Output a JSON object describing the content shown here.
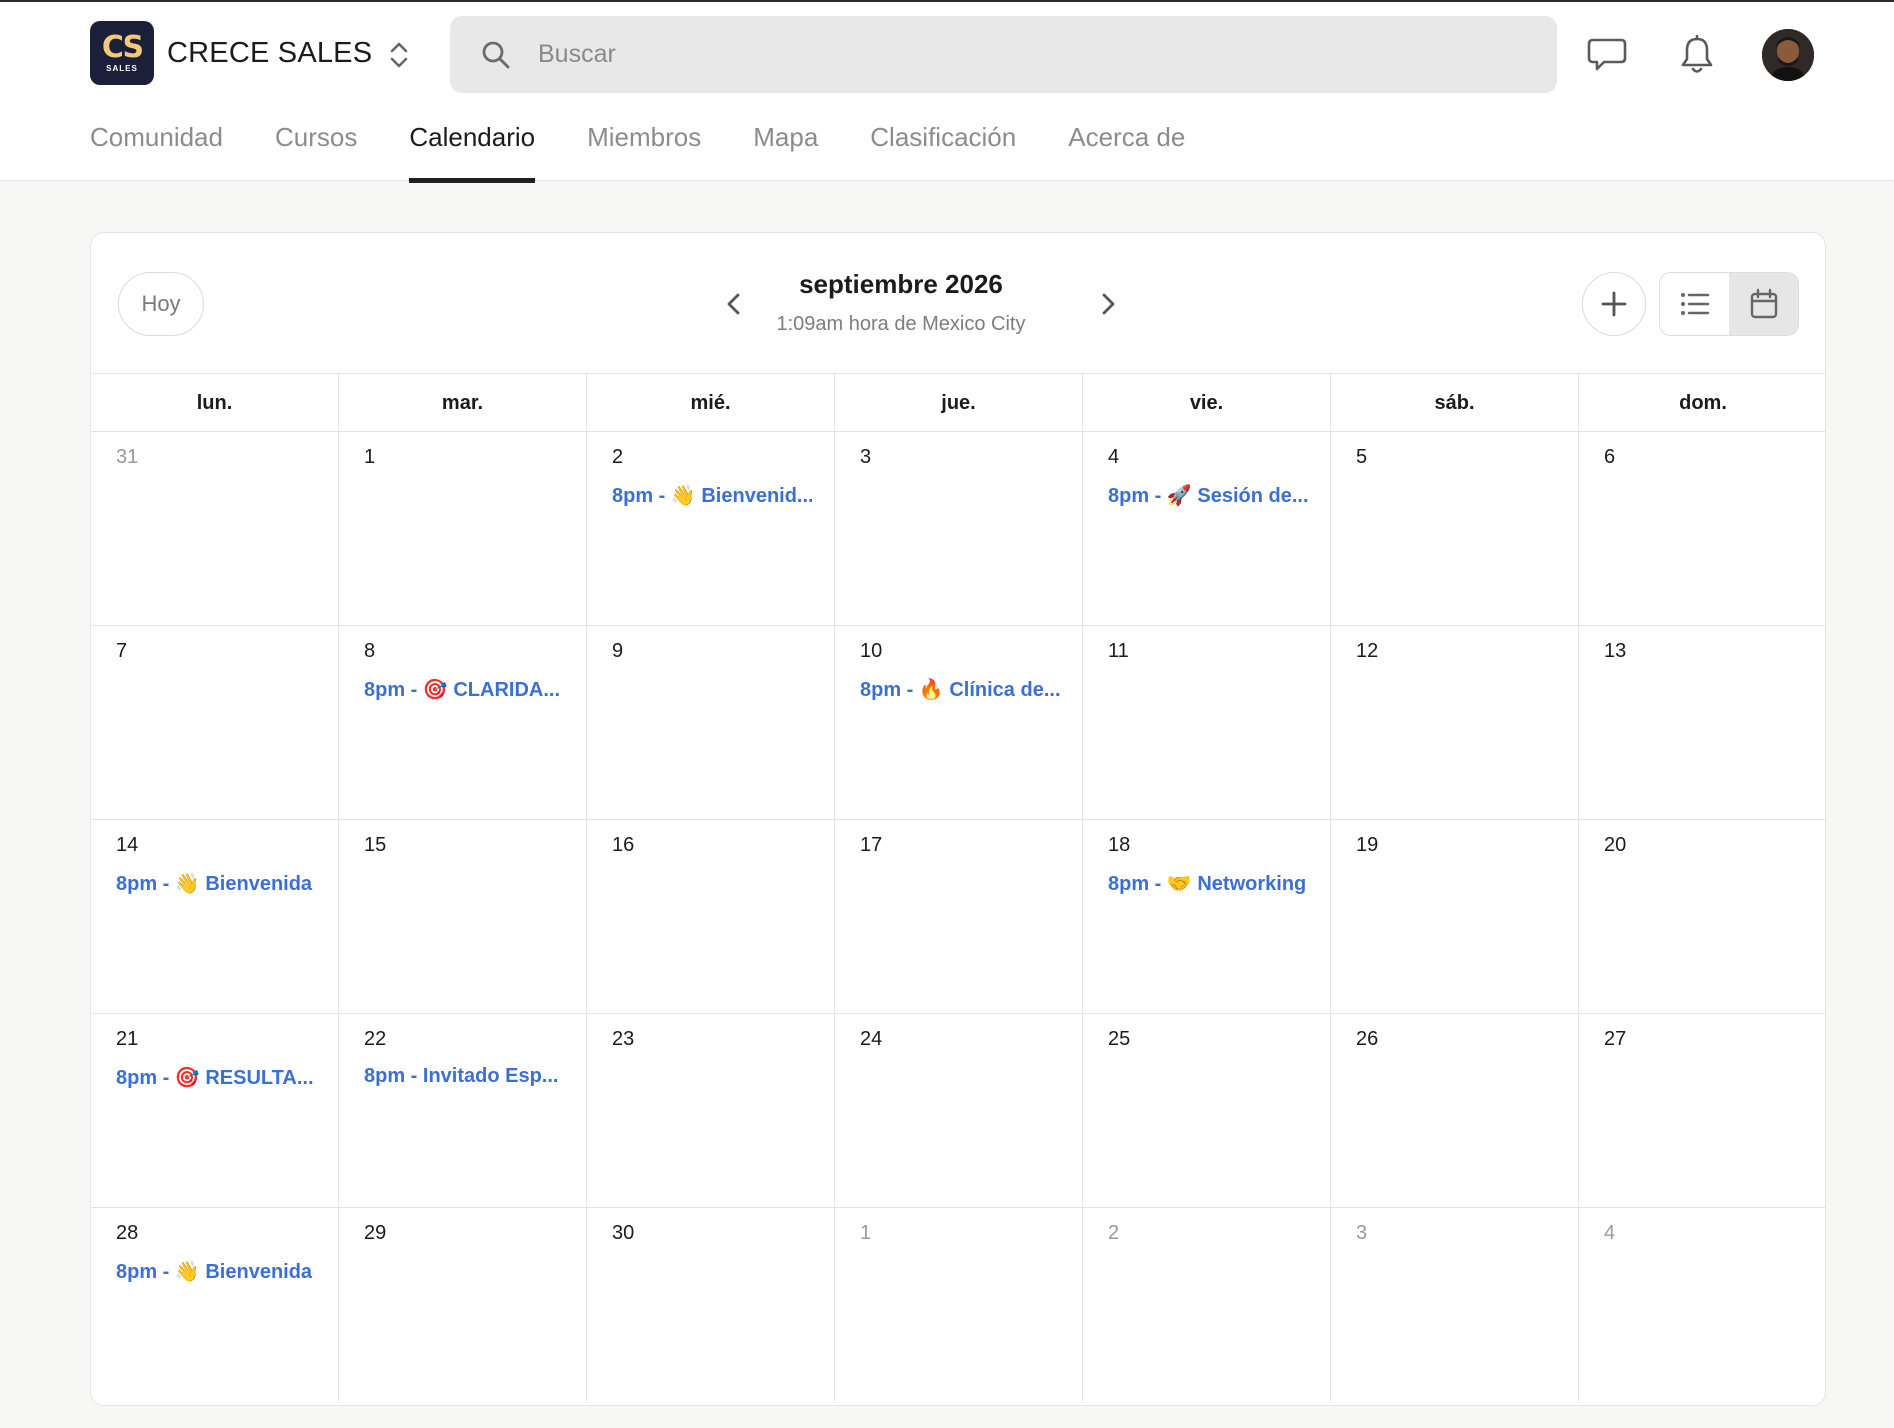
{
  "app": {
    "logo_mark": "CS",
    "logo_sub": "SALES",
    "name": "CRECE SALES"
  },
  "search": {
    "placeholder": "Buscar",
    "value": ""
  },
  "header_icons": [
    "chat-icon",
    "bell-icon"
  ],
  "tabs": [
    {
      "label": "Comunidad",
      "active": false
    },
    {
      "label": "Cursos",
      "active": false
    },
    {
      "label": "Calendario",
      "active": true
    },
    {
      "label": "Miembros",
      "active": false
    },
    {
      "label": "Mapa",
      "active": false
    },
    {
      "label": "Clasificación",
      "active": false
    },
    {
      "label": "Acerca de",
      "active": false
    }
  ],
  "calendar": {
    "today_label": "Hoy",
    "month_title": "septiembre 2026",
    "timezone_text": "1:09am hora de Mexico City",
    "active_view": "calendar",
    "weekdays": [
      "lun.",
      "mar.",
      "mié.",
      "jue.",
      "vie.",
      "sáb.",
      "dom."
    ],
    "weeks": [
      [
        {
          "day": "31",
          "other": true,
          "events": []
        },
        {
          "day": "1",
          "events": []
        },
        {
          "day": "2",
          "events": [
            "8pm - 👋 Bienvenid..."
          ]
        },
        {
          "day": "3",
          "events": []
        },
        {
          "day": "4",
          "events": [
            "8pm - 🚀 Sesión de..."
          ]
        },
        {
          "day": "5",
          "events": []
        },
        {
          "day": "6",
          "events": []
        }
      ],
      [
        {
          "day": "7",
          "events": []
        },
        {
          "day": "8",
          "events": [
            "8pm - 🎯 CLARIDA..."
          ]
        },
        {
          "day": "9",
          "events": []
        },
        {
          "day": "10",
          "events": [
            "8pm - 🔥 Clínica de..."
          ]
        },
        {
          "day": "11",
          "events": []
        },
        {
          "day": "12",
          "events": []
        },
        {
          "day": "13",
          "events": []
        }
      ],
      [
        {
          "day": "14",
          "events": [
            "8pm - 👋 Bienvenida"
          ]
        },
        {
          "day": "15",
          "events": []
        },
        {
          "day": "16",
          "events": []
        },
        {
          "day": "17",
          "events": []
        },
        {
          "day": "18",
          "events": [
            "8pm - 🤝 Networking"
          ]
        },
        {
          "day": "19",
          "events": []
        },
        {
          "day": "20",
          "events": []
        }
      ],
      [
        {
          "day": "21",
          "events": [
            "8pm - 🎯 RESULTA..."
          ]
        },
        {
          "day": "22",
          "events": [
            "8pm - Invitado Esp..."
          ]
        },
        {
          "day": "23",
          "events": []
        },
        {
          "day": "24",
          "events": []
        },
        {
          "day": "25",
          "events": []
        },
        {
          "day": "26",
          "events": []
        },
        {
          "day": "27",
          "events": []
        }
      ],
      [
        {
          "day": "28",
          "events": [
            "8pm - 👋 Bienvenida"
          ]
        },
        {
          "day": "29",
          "events": []
        },
        {
          "day": "30",
          "events": []
        },
        {
          "day": "1",
          "other": true,
          "events": []
        },
        {
          "day": "2",
          "other": true,
          "events": []
        },
        {
          "day": "3",
          "other": true,
          "events": []
        },
        {
          "day": "4",
          "other": true,
          "events": []
        }
      ]
    ]
  }
}
